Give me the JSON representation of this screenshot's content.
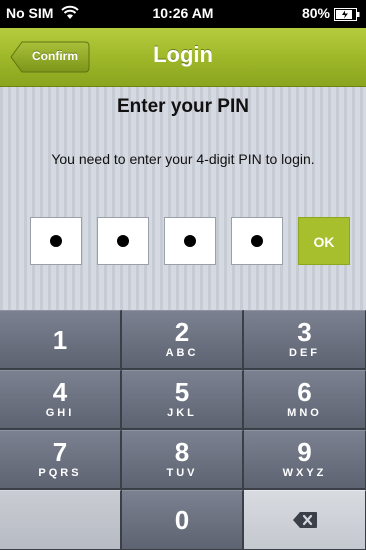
{
  "status_bar": {
    "carrier": "No SIM",
    "time": "10:26 AM",
    "battery_percent": "80%",
    "icons": [
      "wifi-icon",
      "battery-icon"
    ]
  },
  "nav_bar": {
    "title": "Login",
    "back_button_label": "Confirm",
    "color": "#9fb82a"
  },
  "pin_entry": {
    "title": "Enter your PIN",
    "message": "You need to enter your 4-digit PIN to login.",
    "digits_entered": 4,
    "ok_label": "OK",
    "accent_color": "#a7bf2c"
  },
  "keypad": {
    "keys": [
      {
        "digit": "1",
        "letters": ""
      },
      {
        "digit": "2",
        "letters": "ABC"
      },
      {
        "digit": "3",
        "letters": "DEF"
      },
      {
        "digit": "4",
        "letters": "GHI"
      },
      {
        "digit": "5",
        "letters": "JKL"
      },
      {
        "digit": "6",
        "letters": "MNO"
      },
      {
        "digit": "7",
        "letters": "PQRS"
      },
      {
        "digit": "8",
        "letters": "TUV"
      },
      {
        "digit": "9",
        "letters": "WXYZ"
      },
      {
        "digit": "0",
        "letters": ""
      }
    ],
    "delete_icon": "backspace-icon"
  }
}
